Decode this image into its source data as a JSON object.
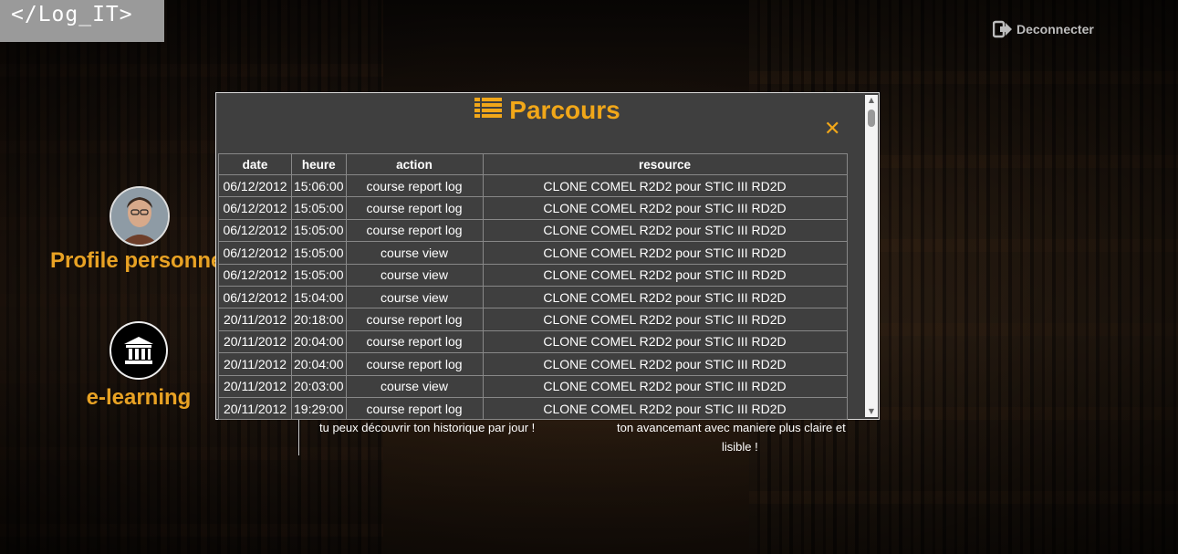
{
  "logo": "</Log_IT>",
  "logout": {
    "label": "Deconnecter"
  },
  "menu": {
    "profile_label": "Profile personnel",
    "elearning_label": "e-learning"
  },
  "descriptions": {
    "left": "tu peux découvrir ton historique par jour !",
    "right_line1": "ton avancemant avec maniere plus claire et",
    "right_line2": "lisible !"
  },
  "modal": {
    "title": "Parcours",
    "close_symbol": "✕",
    "columns": [
      "date",
      "heure",
      "action",
      "resource"
    ],
    "rows": [
      {
        "date": "06/12/2012",
        "heure": "15:06:00",
        "action": "course report log",
        "resource": "CLONE COMEL R2D2 pour STIC III RD2D"
      },
      {
        "date": "06/12/2012",
        "heure": "15:05:00",
        "action": "course report log",
        "resource": "CLONE COMEL R2D2 pour STIC III RD2D"
      },
      {
        "date": "06/12/2012",
        "heure": "15:05:00",
        "action": "course report log",
        "resource": "CLONE COMEL R2D2 pour STIC III RD2D"
      },
      {
        "date": "06/12/2012",
        "heure": "15:05:00",
        "action": "course view",
        "resource": "CLONE COMEL R2D2 pour STIC III RD2D"
      },
      {
        "date": "06/12/2012",
        "heure": "15:05:00",
        "action": "course view",
        "resource": "CLONE COMEL R2D2 pour STIC III RD2D"
      },
      {
        "date": "06/12/2012",
        "heure": "15:04:00",
        "action": "course view",
        "resource": "CLONE COMEL R2D2 pour STIC III RD2D"
      },
      {
        "date": "20/11/2012",
        "heure": "20:18:00",
        "action": "course report log",
        "resource": "CLONE COMEL R2D2 pour STIC III RD2D"
      },
      {
        "date": "20/11/2012",
        "heure": "20:04:00",
        "action": "course report log",
        "resource": "CLONE COMEL R2D2 pour STIC III RD2D"
      },
      {
        "date": "20/11/2012",
        "heure": "20:04:00",
        "action": "course report log",
        "resource": "CLONE COMEL R2D2 pour STIC III RD2D"
      },
      {
        "date": "20/11/2012",
        "heure": "20:03:00",
        "action": "course view",
        "resource": "CLONE COMEL R2D2 pour STIC III RD2D"
      },
      {
        "date": "20/11/2012",
        "heure": "19:29:00",
        "action": "course report log",
        "resource": "CLONE COMEL R2D2 pour STIC III RD2D"
      }
    ]
  },
  "colors": {
    "accent": "#f1a719",
    "menu_label": "#e8a224",
    "modal_bg": "#3f3f3f"
  },
  "icons": [
    "logout-icon",
    "list-icon",
    "bank-icon",
    "close-icon"
  ]
}
